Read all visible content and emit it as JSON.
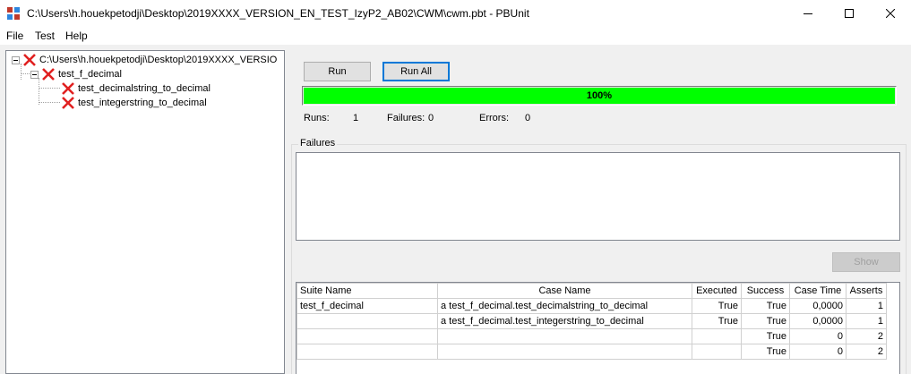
{
  "window": {
    "title": "C:\\Users\\h.houekpetodji\\Desktop\\2019XXXX_VERSION_EN_TEST_IzyP2_AB02\\CWM\\cwm.pbt - PBUnit",
    "minimize_icon": "minimize-icon",
    "maximize_icon": "maximize-icon",
    "close_icon": "close-icon"
  },
  "menu": [
    {
      "label": "File"
    },
    {
      "label": "Test"
    },
    {
      "label": "Help"
    }
  ],
  "tree": {
    "root": {
      "label": "C:\\Users\\h.houekpetodji\\Desktop\\2019XXXX_VERSIO",
      "status_icon": "fail-x-icon"
    },
    "suite": {
      "label": "test_f_decimal",
      "status_icon": "fail-x-icon"
    },
    "cases": [
      {
        "label": "test_decimalstring_to_decimal",
        "status_icon": "fail-x-icon"
      },
      {
        "label": "test_integerstring_to_decimal",
        "status_icon": "fail-x-icon"
      }
    ]
  },
  "controls": {
    "run_label": "Run",
    "run_all_label": "Run All",
    "show_label": "Show"
  },
  "progress": {
    "value": 1.0,
    "label": "100%",
    "color": "#00ff00"
  },
  "stats": {
    "runs_label": "Runs:",
    "runs_value": "1",
    "failures_label": "Failures:",
    "failures_value": "0",
    "errors_label": "Errors:",
    "errors_value": "0"
  },
  "failures": {
    "label": "Failures"
  },
  "cases_table": {
    "headers": [
      "Suite Name",
      "Case Name",
      "Executed",
      "Success",
      "Case Time",
      "Asserts"
    ],
    "rows": [
      [
        "test_f_decimal",
        "a test_f_decimal.test_decimalstring_to_decimal",
        "True",
        "True",
        "0,0000",
        "1"
      ],
      [
        "",
        "a test_f_decimal.test_integerstring_to_decimal",
        "True",
        "True",
        "0,0000",
        "1"
      ],
      [
        "",
        "",
        "",
        "True",
        "0",
        "2"
      ],
      [
        "",
        "",
        "",
        "True",
        "0",
        "2"
      ]
    ]
  }
}
